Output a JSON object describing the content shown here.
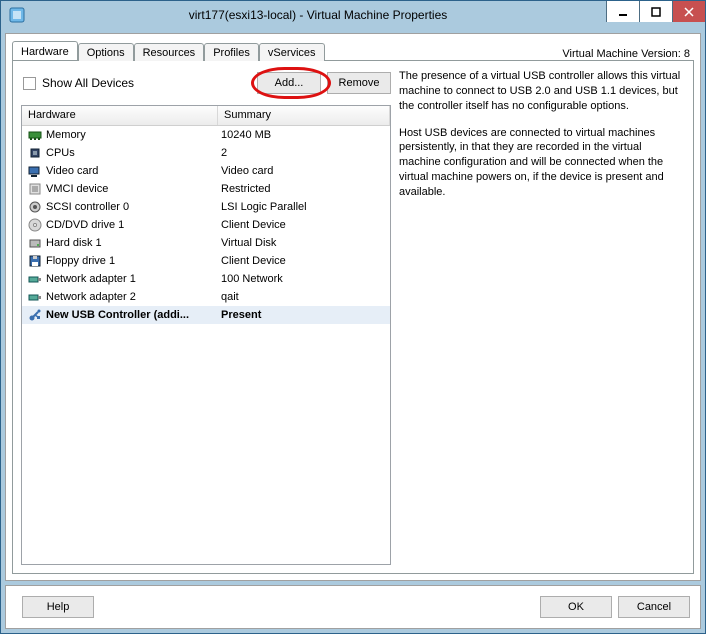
{
  "window": {
    "title": "virt177(esxi13-local) - Virtual Machine Properties"
  },
  "version_label": "Virtual Machine Version: 8",
  "tabs": [
    {
      "label": "Hardware"
    },
    {
      "label": "Options"
    },
    {
      "label": "Resources"
    },
    {
      "label": "Profiles"
    },
    {
      "label": "vServices"
    }
  ],
  "show_all_label": "Show All Devices",
  "buttons": {
    "add": "Add...",
    "remove": "Remove",
    "help": "Help",
    "ok": "OK",
    "cancel": "Cancel"
  },
  "columns": {
    "hardware": "Hardware",
    "summary": "Summary"
  },
  "devices": [
    {
      "icon": "memory",
      "name": "Memory",
      "summary": "10240 MB"
    },
    {
      "icon": "cpu",
      "name": "CPUs",
      "summary": "2"
    },
    {
      "icon": "video",
      "name": "Video card",
      "summary": "Video card"
    },
    {
      "icon": "vmci",
      "name": "VMCI device",
      "summary": "Restricted"
    },
    {
      "icon": "scsi",
      "name": "SCSI controller 0",
      "summary": "LSI Logic Parallel"
    },
    {
      "icon": "cd",
      "name": "CD/DVD drive 1",
      "summary": "Client Device"
    },
    {
      "icon": "disk",
      "name": "Hard disk 1",
      "summary": "Virtual Disk"
    },
    {
      "icon": "floppy",
      "name": "Floppy drive 1",
      "summary": "Client Device"
    },
    {
      "icon": "nic",
      "name": "Network adapter 1",
      "summary": "100 Network"
    },
    {
      "icon": "nic",
      "name": "Network adapter 2",
      "summary": "qait"
    },
    {
      "icon": "usb",
      "name": "New USB Controller (addi...",
      "summary": "Present",
      "selected": true
    }
  ],
  "info": {
    "p1": "The presence of a virtual USB controller allows this virtual machine to connect to USB 2.0 and USB 1.1 devices,  but the controller itself has no configurable options.",
    "p2": "Host USB devices are connected to virtual machines persistently, in that they are recorded in the virtual machine configuration and will be connected when the virtual machine powers on, if the device is present and available."
  }
}
